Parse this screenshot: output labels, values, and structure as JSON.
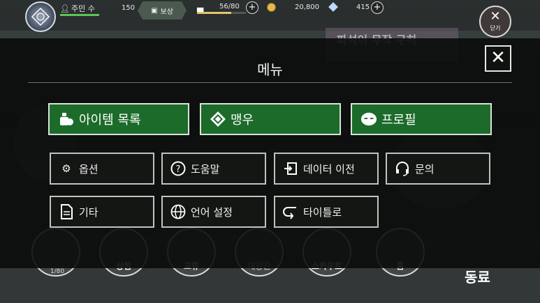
{
  "hud": {
    "player_name": "주민 수",
    "level": "150",
    "reward_label": "보상",
    "stamina": "56/80",
    "stamina_fraction": 0.7,
    "gold": "20,800",
    "gems": "415",
    "close_label": "닫기"
  },
  "banner": {
    "text": "파석이 무작 구히"
  },
  "menu": {
    "title": "메뉴",
    "primary": [
      {
        "label": "아이템 목록",
        "icon": "item-bag-icon"
      },
      {
        "label": "맹우",
        "icon": "handshake-icon"
      },
      {
        "label": "프로필",
        "icon": "profile-face-icon"
      }
    ],
    "secondary": [
      {
        "label": "옵션",
        "icon": "gear-icon"
      },
      {
        "label": "도움말",
        "icon": "help-icon"
      },
      {
        "label": "데이터 이전",
        "icon": "data-transfer-icon"
      },
      {
        "label": "문의",
        "icon": "headset-icon"
      },
      {
        "label": "기타",
        "icon": "document-icon"
      },
      {
        "label": "언어 설정",
        "icon": "globe-icon"
      },
      {
        "label": "타이틀로",
        "icon": "return-icon"
      }
    ]
  },
  "bottom_nav": {
    "items": [
      "상점",
      "교류",
      "대장간",
      "스카우트",
      "홈"
    ],
    "page_count": "1/80",
    "companion": "동료"
  },
  "colors": {
    "primary_button": "#1c6b2a",
    "secondary_button": "#141614",
    "overlay": "#0a0c0b"
  }
}
